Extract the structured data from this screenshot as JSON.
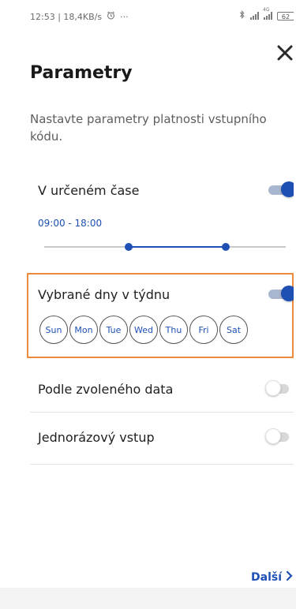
{
  "status_bar": {
    "time_speed": "12:53 | 18,4KB/s",
    "more": "···",
    "battery": "62",
    "signal_tag": "4G"
  },
  "header": {
    "title": "Parametry",
    "description": "Nastavte parametry platnosti vstupního kódu."
  },
  "options": {
    "time": {
      "label": "V určeném čase",
      "enabled": true,
      "range_text": "09:00 - 18:00",
      "range_start_fraction": 0.35,
      "range_end_fraction": 0.75
    },
    "weekdays": {
      "label": "Vybrané dny v týdnu",
      "enabled": true,
      "days": [
        "Sun",
        "Mon",
        "Tue",
        "Wed",
        "Thu",
        "Fri",
        "Sat"
      ]
    },
    "date": {
      "label": "Podle zvoleného data",
      "enabled": false
    },
    "single": {
      "label": "Jednorázový vstup",
      "enabled": false
    }
  },
  "footer": {
    "next_label": "Další"
  },
  "colors": {
    "accent": "#1e50b4",
    "highlight_border": "#ee8a3c"
  }
}
